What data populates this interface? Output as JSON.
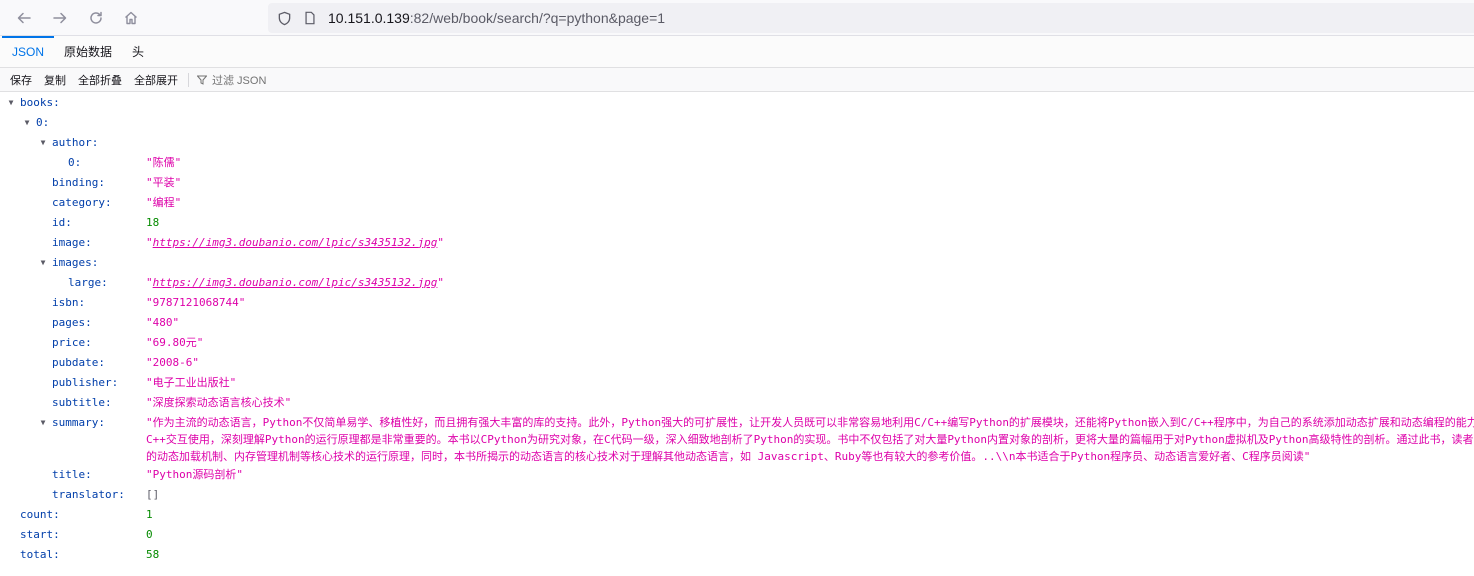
{
  "browser": {
    "url_host": "10.151.0.139",
    "url_rest": ":82/web/book/search/?q=python&page=1"
  },
  "tabs": [
    "JSON",
    "原始数据",
    "头"
  ],
  "toolbar": {
    "save": "保存",
    "copy": "复制",
    "collapse_all": "全部折叠",
    "expand_all": "全部展开",
    "filter": "过滤 JSON"
  },
  "json": {
    "books_key": "books:",
    "index0_key": "0:",
    "author_key": "author:",
    "author0_key": "0:",
    "author0_val": "\"陈儒\"",
    "binding_key": "binding:",
    "binding_val": "\"平装\"",
    "category_key": "category:",
    "category_val": "\"编程\"",
    "id_key": "id:",
    "id_val": "18",
    "image_key": "image:",
    "image_val": "https://img3.doubanio.com/lpic/s3435132.jpg",
    "images_key": "images:",
    "large_key": "large:",
    "large_val": "https://img3.doubanio.com/lpic/s3435132.jpg",
    "isbn_key": "isbn:",
    "isbn_val": "\"9787121068744\"",
    "pages_key": "pages:",
    "pages_val": "\"480\"",
    "price_key": "price:",
    "price_val": "\"69.80元\"",
    "pubdate_key": "pubdate:",
    "pubdate_val": "\"2008-6\"",
    "publisher_key": "publisher:",
    "publisher_val": "\"电子工业出版社\"",
    "subtitle_key": "subtitle:",
    "subtitle_val": "\"深度探索动态语言核心技术\"",
    "summary_key": "summary:",
    "summary_lines": [
      "\"作为主流的动态语言，Python不仅简单易学、移植性好，而且拥有强大丰富的库的支持。此外，Python强大的可扩展性，让开发人员既可以非常容易地利用C/C++编写Python的扩展模块，还能将Python嵌入到C/C++程序中，为自己的系统添加动态扩展和动态编程的能力",
      "C++交互使用，深刻理解Python的运行原理都是非常重要的。本书以CPython为研究对象，在C代码一级，深入细致地剖析了Python的实现。书中不仅包括了对大量Python内置对象的剖析，更将大量的篇幅用于对Python虚拟机及Python高级特性的剖析。通过此书，读者",
      "的动态加载机制、内存管理机制等核心技术的运行原理，同时，本书所揭示的动态语言的核心技术对于理解其他动态语言，如 Javascript、Ruby等也有较大的参考价值。..\\\\n本书适合于Python程序员、动态语言爱好者、C程序员阅读\""
    ],
    "title_key": "title:",
    "title_val": "\"Python源码剖析\"",
    "translator_key": "translator:",
    "translator_val": "[]",
    "count_key": "count:",
    "count_val": "1",
    "start_key": "start:",
    "start_val": "0",
    "total_key": "total:",
    "total_val": "58"
  }
}
